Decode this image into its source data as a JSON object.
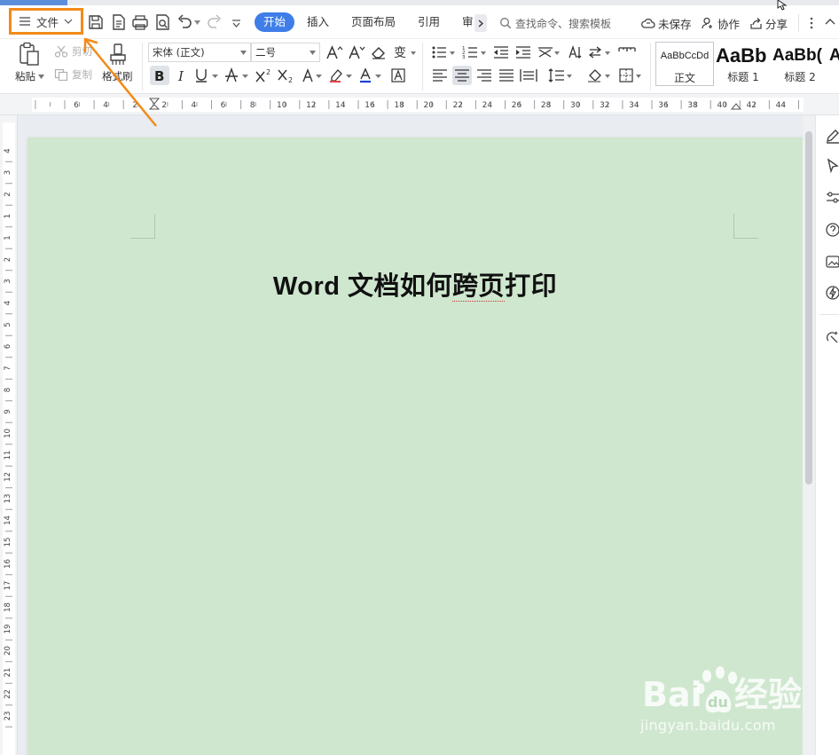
{
  "menubar": {
    "file_label": "文件",
    "tabs": [
      "开始",
      "插入",
      "页面布局",
      "引用",
      "审"
    ],
    "search_placeholder": "查找命令、搜索模板",
    "unsaved_label": "未保存",
    "collab_label": "协作",
    "share_label": "分享"
  },
  "ribbon": {
    "paste_label": "粘贴",
    "cut_label": "剪切",
    "copy_label": "复制",
    "format_painter_label": "格式刷",
    "font_name": "宋体 (正文)",
    "font_size": "二号",
    "styles": [
      {
        "preview": "AaBbCcDd",
        "label": "正文"
      },
      {
        "preview": "AaBb",
        "label": "标题 1"
      },
      {
        "preview": "AaBb(",
        "label": "标题 2"
      },
      {
        "preview": "A",
        "label": ""
      }
    ]
  },
  "ruler": {
    "h_labels": [
      "6",
      "4",
      "2",
      "2",
      "4",
      "6",
      "8",
      "10",
      "12",
      "14",
      "16",
      "18",
      "20",
      "22",
      "24",
      "26",
      "28",
      "30",
      "32",
      "34",
      "36",
      "38",
      "40",
      "42",
      "44"
    ],
    "v_labels": [
      "4",
      "3",
      "2",
      "1",
      "1",
      "2",
      "3",
      "4",
      "5",
      "6",
      "7",
      "8",
      "9",
      "10",
      "11",
      "12",
      "13",
      "14",
      "15",
      "16",
      "17",
      "18",
      "19",
      "20",
      "21",
      "22",
      "23"
    ]
  },
  "document": {
    "title_prefix": "Word ",
    "title_main": "文档如何",
    "title_squiggly": "跨页",
    "title_suffix": "打印"
  },
  "watermark": {
    "brand": "Bai du 经验",
    "domain": "jingyan.baidu.com"
  },
  "colors": {
    "accent": "#3f7de8",
    "highlight": "#f28b1a",
    "page_bg": "#cfe7cf"
  }
}
